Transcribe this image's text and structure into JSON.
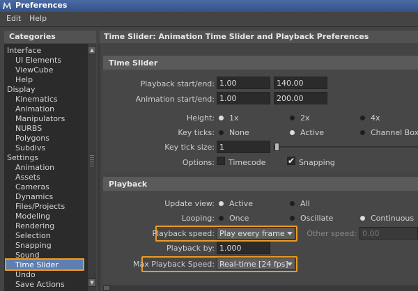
{
  "window": {
    "title": "Preferences",
    "icon": "maya-app-icon"
  },
  "menu": {
    "items": [
      "Edit",
      "Help"
    ]
  },
  "categories": {
    "header": "Categories",
    "items": [
      {
        "label": "Interface",
        "level": 0
      },
      {
        "label": "UI Elements",
        "level": 1
      },
      {
        "label": "ViewCube",
        "level": 1
      },
      {
        "label": "Help",
        "level": 1
      },
      {
        "label": "Display",
        "level": 0
      },
      {
        "label": "Kinematics",
        "level": 1
      },
      {
        "label": "Animation",
        "level": 1
      },
      {
        "label": "Manipulators",
        "level": 1
      },
      {
        "label": "NURBS",
        "level": 1
      },
      {
        "label": "Polygons",
        "level": 1
      },
      {
        "label": "Subdivs",
        "level": 1
      },
      {
        "label": "Settings",
        "level": 0
      },
      {
        "label": "Animation",
        "level": 1
      },
      {
        "label": "Assets",
        "level": 1
      },
      {
        "label": "Cameras",
        "level": 1
      },
      {
        "label": "Dynamics",
        "level": 1
      },
      {
        "label": "Files/Projects",
        "level": 1
      },
      {
        "label": "Modeling",
        "level": 1
      },
      {
        "label": "Rendering",
        "level": 1
      },
      {
        "label": "Selection",
        "level": 1
      },
      {
        "label": "Snapping",
        "level": 1
      },
      {
        "label": "Sound",
        "level": 1
      },
      {
        "label": "Time Slider",
        "level": 1,
        "selected": true
      },
      {
        "label": "Undo",
        "level": 1
      },
      {
        "label": "Save Actions",
        "level": 1
      }
    ]
  },
  "section": {
    "title": "Time Slider: Animation Time Slider and Playback Preferences"
  },
  "time_slider": {
    "title": "Time Slider",
    "playback_label": "Playback start/end:",
    "playback_start": "1.00",
    "playback_end": "140.00",
    "animation_label": "Animation start/end:",
    "animation_start": "1.00",
    "animation_end": "200.00",
    "height_label": "Height:",
    "height_options": [
      "1x",
      "2x",
      "4x"
    ],
    "height_selected": "1x",
    "key_ticks_label": "Key ticks:",
    "key_ticks_options": [
      "None",
      "Active",
      "Channel Box"
    ],
    "key_ticks_selected": "Active",
    "key_tick_size_label": "Key tick size:",
    "key_tick_size": "1",
    "options_label": "Options:",
    "timecode_label": "Timecode",
    "timecode_checked": false,
    "snapping_label": "Snapping",
    "snapping_checked": true
  },
  "playback": {
    "title": "Playback",
    "update_view_label": "Update view:",
    "update_view_options": [
      "Active",
      "All"
    ],
    "update_view_selected": "Active",
    "looping_label": "Looping:",
    "looping_options": [
      "Once",
      "Oscillate",
      "Continuous"
    ],
    "looping_selected": "Continuous",
    "playback_speed_label": "Playback speed:",
    "playback_speed_value": "Play every frame",
    "other_speed_label": "Other speed:",
    "other_speed_value": "0.00",
    "playback_by_label": "Playback by:",
    "playback_by_value": "1.000",
    "max_speed_label": "Max Playback Speed:",
    "max_speed_value": "Real-time [24 fps]"
  },
  "colors": {
    "highlight": "#f09a20",
    "selection": "#5e7fb0",
    "titlebar": "#3d5c94"
  }
}
